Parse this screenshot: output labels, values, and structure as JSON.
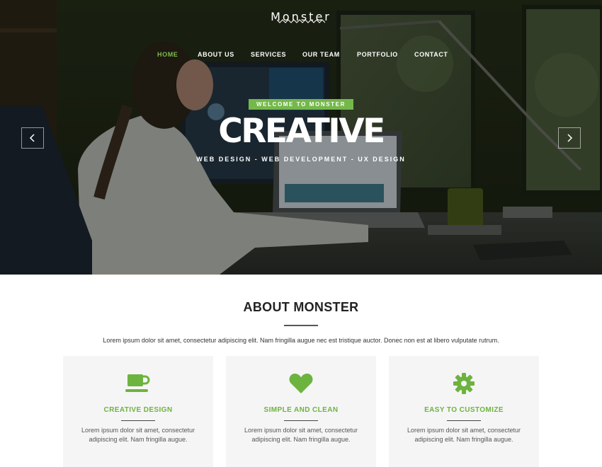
{
  "brand": {
    "logo": "Monster"
  },
  "nav": {
    "items": [
      {
        "label": "HOME",
        "active": true
      },
      {
        "label": "ABOUT US",
        "active": false
      },
      {
        "label": "SERVICES",
        "active": false
      },
      {
        "label": "OUR TEAM",
        "active": false
      },
      {
        "label": "PORTFOLIO",
        "active": false
      },
      {
        "label": "CONTACT",
        "active": false
      }
    ]
  },
  "hero": {
    "badge": "WELCOME TO MONSTER",
    "headline": "CREATIVE",
    "subline": "WEB DESIGN - WEB DEVELOPMENT - UX DESIGN",
    "prev_icon": "chevron-left-icon",
    "next_icon": "chevron-right-icon"
  },
  "about": {
    "title": "ABOUT MONSTER",
    "text": "Lorem ipsum dolor sit amet, consectetur adipiscing elit. Nam fringilla augue nec est tristique auctor. Donec non est at libero vulputate rutrum.",
    "features": [
      {
        "icon": "coffee-cup-icon",
        "title": "CREATIVE DESIGN",
        "text": "Lorem ipsum dolor sit amet, consectetur adipiscing elit. Nam fringilla augue."
      },
      {
        "icon": "heart-icon",
        "title": "SIMPLE AND CLEAN",
        "text": "Lorem ipsum dolor sit amet, consectetur adipiscing elit. Nam fringilla augue."
      },
      {
        "icon": "gear-icon",
        "title": "EASY TO CUSTOMIZE",
        "text": "Lorem ipsum dolor sit amet, consectetur adipiscing elit. Nam fringilla augue."
      }
    ]
  },
  "colors": {
    "accent": "#6db33f",
    "badge": "#74b84a",
    "card_bg": "#f5f5f5",
    "title": "#222222"
  }
}
